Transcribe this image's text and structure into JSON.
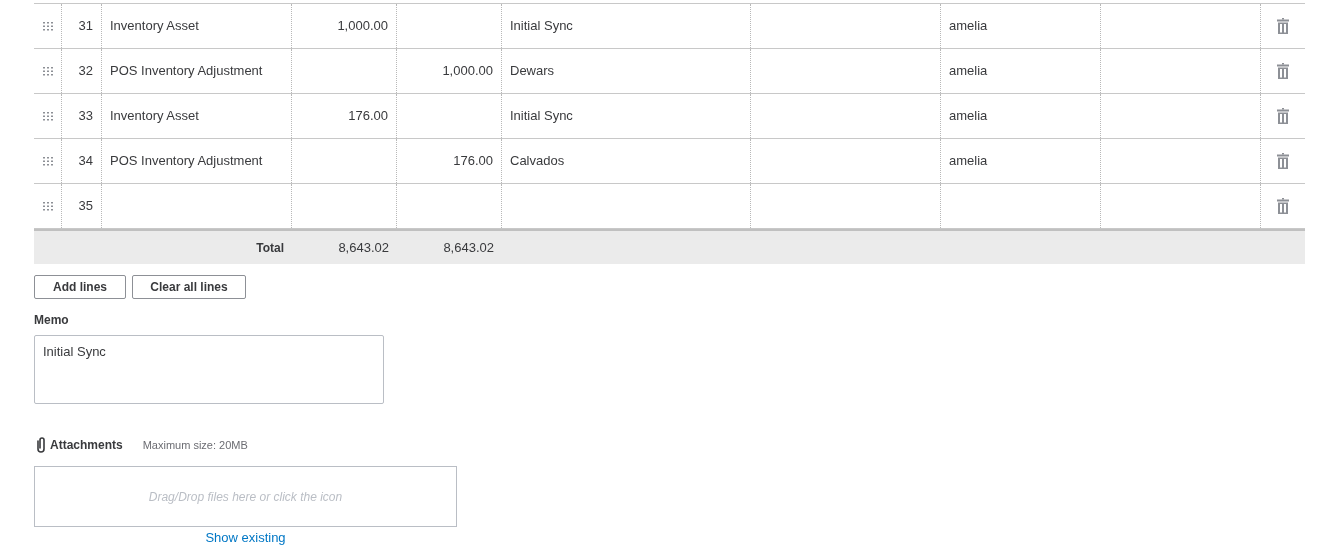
{
  "journal_lines": [
    {
      "line": "31",
      "account": "Inventory Asset",
      "debit": "1,000.00",
      "description": "Initial Sync",
      "column_8": "amelia"
    },
    {
      "line": "32",
      "account": "POS Inventory Adjustment",
      "credit": "1,000.00",
      "description": "Dewars",
      "column_8": "amelia"
    },
    {
      "line": "33",
      "account": "Inventory Asset",
      "debit": "176.00",
      "description": "Initial Sync",
      "column_8": "amelia"
    },
    {
      "line": "34",
      "account": "POS Inventory Adjustment",
      "credit": "176.00",
      "description": "Calvados",
      "column_8": "amelia"
    },
    {
      "line": "35"
    }
  ],
  "total": {
    "label": "Total",
    "debit": "8,643.02",
    "credit": "8,643.02"
  },
  "buttons": [
    "Add lines",
    "Clear all lines"
  ],
  "memo": {
    "label": "Memo",
    "value": "Initial Sync"
  },
  "attachments": {
    "label": "Attachments",
    "max_size": "Maximum size: 20MB",
    "dropzone": "Drag/Drop files here or click the icon",
    "link": "Show existing"
  }
}
